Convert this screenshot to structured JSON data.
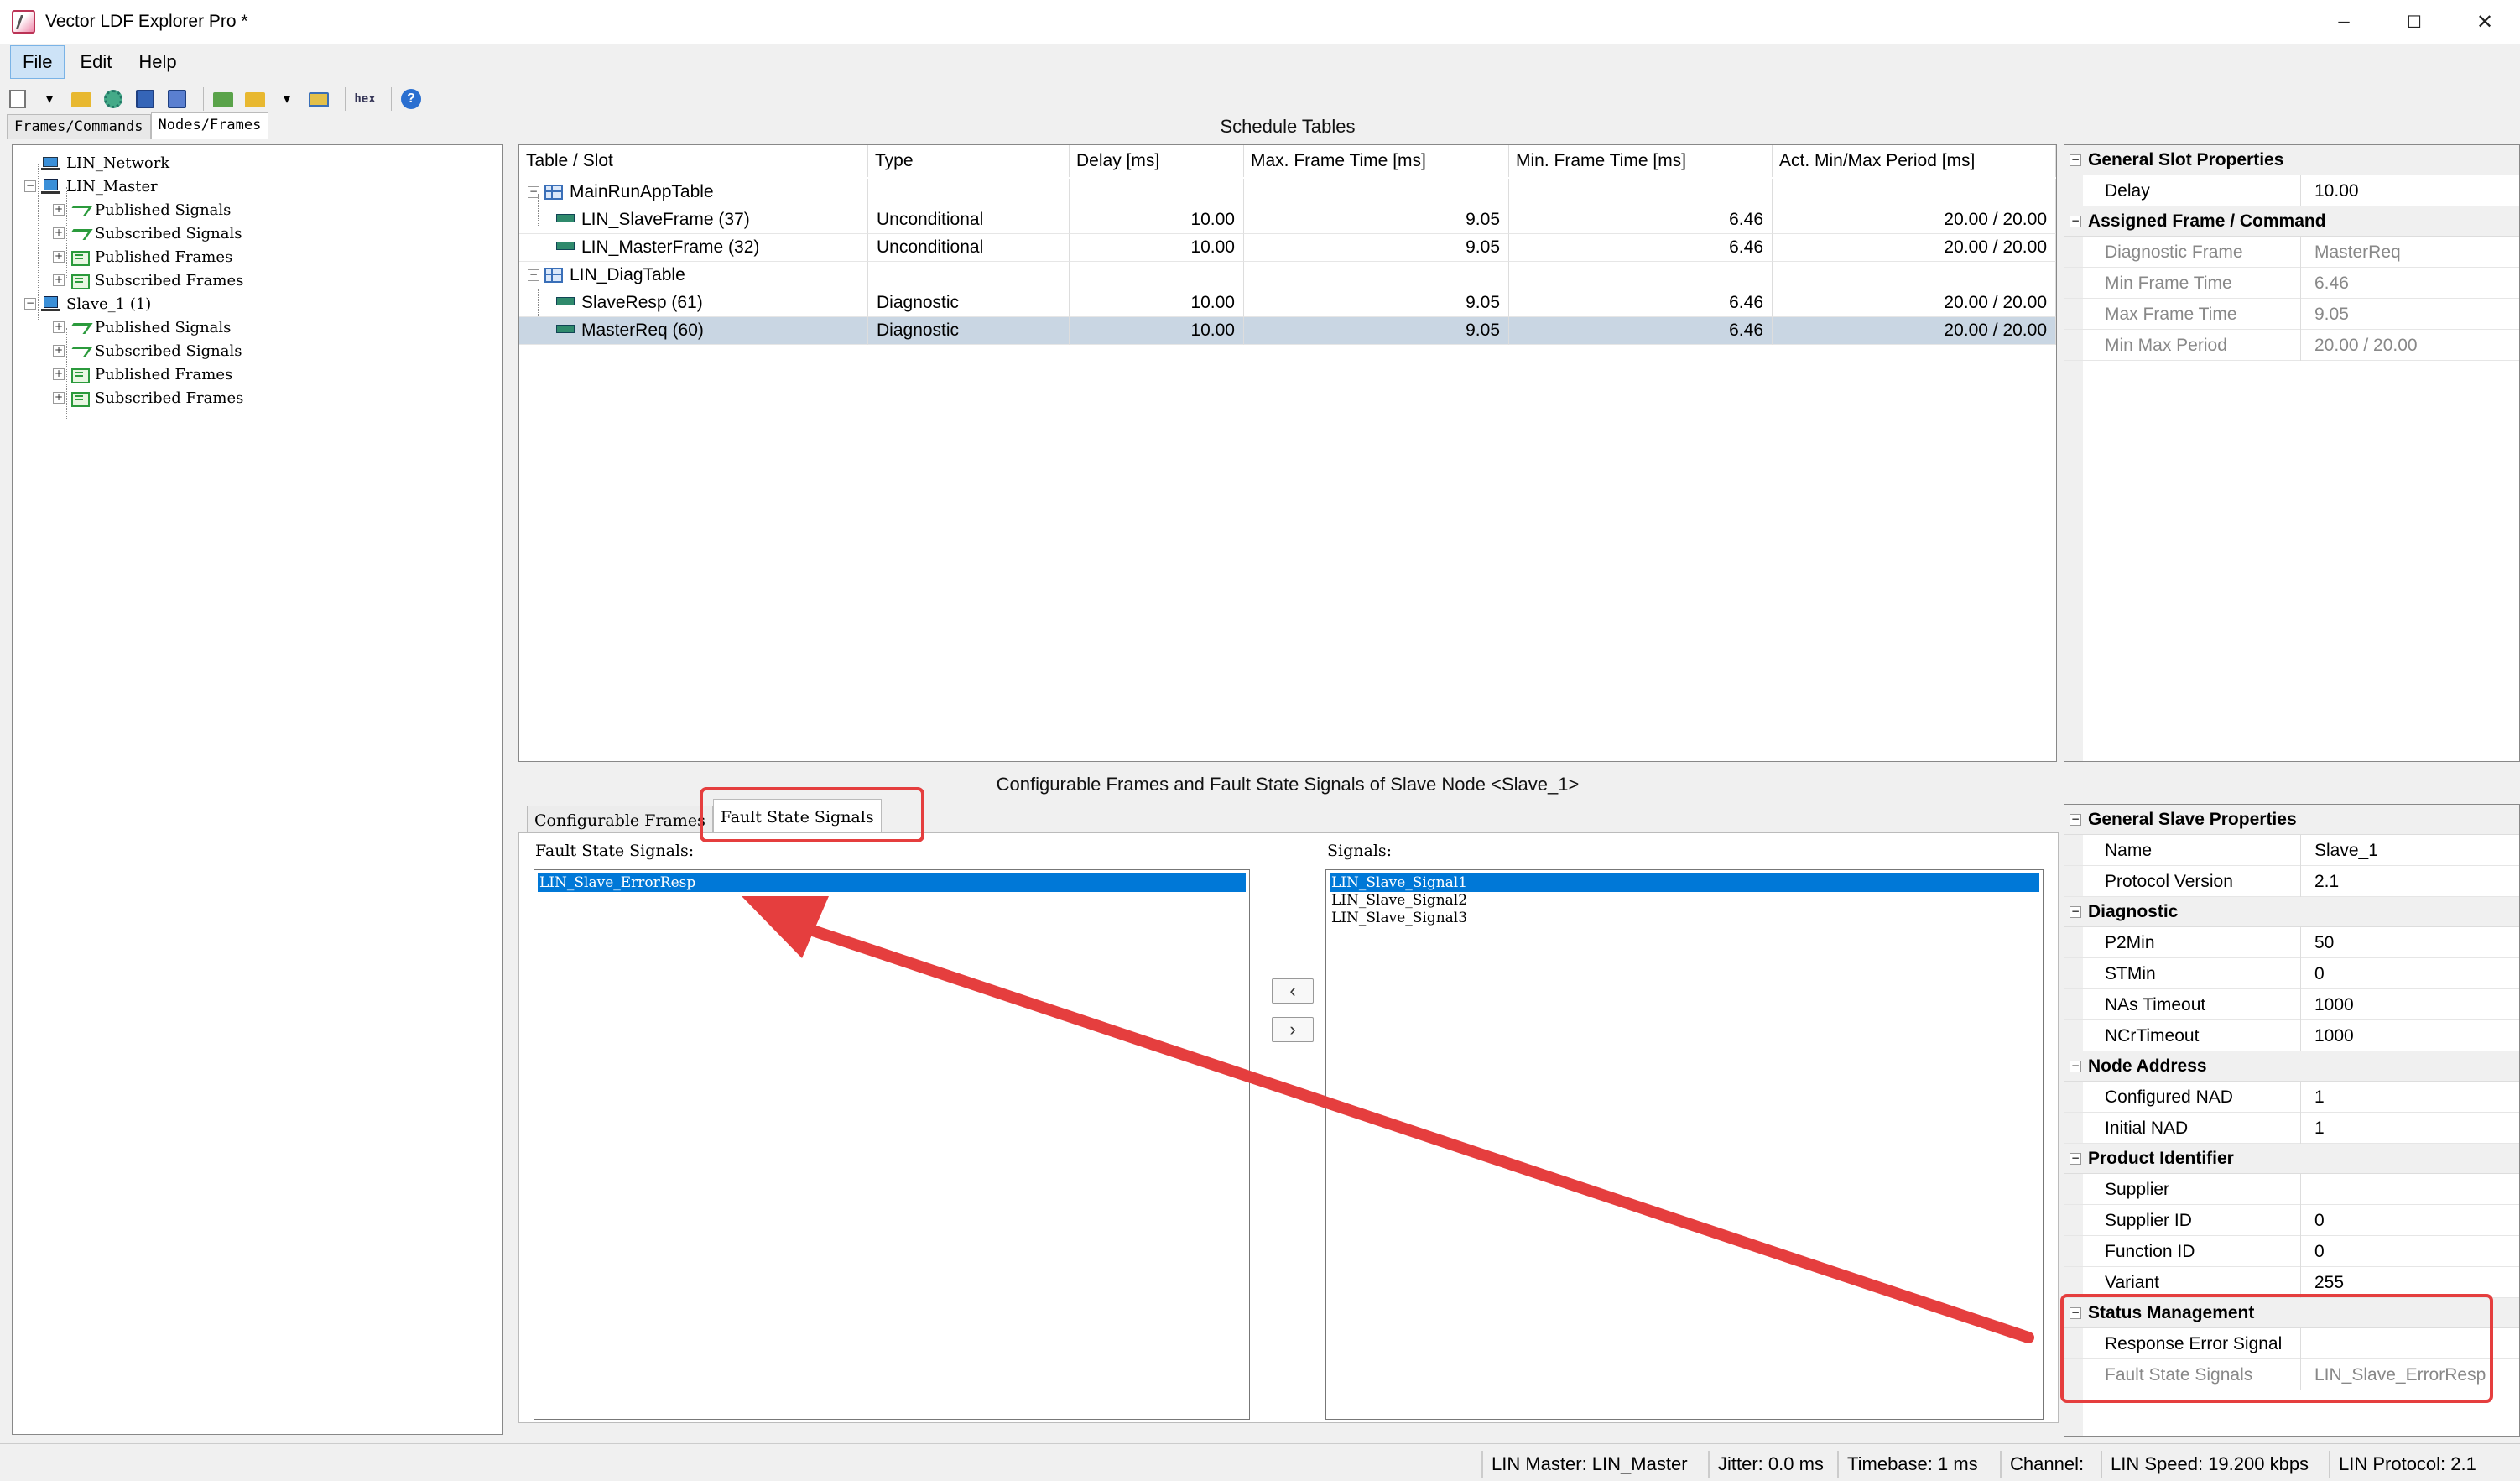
{
  "window": {
    "title": "Vector LDF Explorer Pro *",
    "minimize": "–",
    "maximize": "☐",
    "close": "✕"
  },
  "menu": [
    "File",
    "Edit",
    "Help"
  ],
  "toolbar": {
    "hex_label": "hex"
  },
  "left_tabs": [
    "Frames/Commands",
    "Nodes/Frames"
  ],
  "tree": [
    {
      "label": "LIN_Network",
      "icon": "network-icon",
      "level": 0
    },
    {
      "label": "LIN_Master",
      "icon": "node-icon",
      "level": 0,
      "expander": "−"
    },
    {
      "label": "Published Signals",
      "icon": "signal-icon",
      "level": 1,
      "expander": "+"
    },
    {
      "label": "Subscribed Signals",
      "icon": "signal-icon",
      "level": 1,
      "expander": "+"
    },
    {
      "label": "Published Frames",
      "icon": "frame-icon",
      "level": 1,
      "expander": "+"
    },
    {
      "label": "Subscribed Frames",
      "icon": "frame-icon",
      "level": 1,
      "expander": "+"
    },
    {
      "label": "Slave_1 (1)",
      "icon": "node-icon",
      "level": 0,
      "expander": "−"
    },
    {
      "label": "Published Signals",
      "icon": "signal-icon",
      "level": 1,
      "expander": "+"
    },
    {
      "label": "Subscribed Signals",
      "icon": "signal-icon",
      "level": 1,
      "expander": "+"
    },
    {
      "label": "Published Frames",
      "icon": "frame-icon",
      "level": 1,
      "expander": "+"
    },
    {
      "label": "Subscribed Frames",
      "icon": "frame-icon",
      "level": 1,
      "expander": "+"
    }
  ],
  "schedule": {
    "title": "Schedule Tables",
    "columns": [
      "Table / Slot",
      "Type",
      "Delay [ms]",
      "Max. Frame Time [ms]",
      "Min. Frame Time [ms]",
      "Act. Min/Max Period [ms]"
    ],
    "rows": [
      {
        "name": "MainRunAppTable",
        "kind": "table",
        "expander": "−",
        "cells": [
          "",
          "",
          "",
          "",
          ""
        ]
      },
      {
        "name": "LIN_SlaveFrame (37)",
        "kind": "slot",
        "cells": [
          "Unconditional",
          "10.00",
          "9.05",
          "6.46",
          "20.00 / 20.00"
        ]
      },
      {
        "name": "LIN_MasterFrame (32)",
        "kind": "slot",
        "cells": [
          "Unconditional",
          "10.00",
          "9.05",
          "6.46",
          "20.00 / 20.00"
        ]
      },
      {
        "name": "LIN_DiagTable",
        "kind": "table",
        "expander": "−",
        "cells": [
          "",
          "",
          "",
          "",
          ""
        ]
      },
      {
        "name": "SlaveResp (61)",
        "kind": "slot",
        "cells": [
          "Diagnostic",
          "10.00",
          "9.05",
          "6.46",
          "20.00 / 20.00"
        ]
      },
      {
        "name": "MasterReq (60)",
        "kind": "slot",
        "selected": true,
        "cells": [
          "Diagnostic",
          "10.00",
          "9.05",
          "6.46",
          "20.00 / 20.00"
        ]
      }
    ]
  },
  "slot_props": {
    "categories": [
      {
        "name": "General Slot Properties",
        "items": [
          {
            "k": "Delay",
            "v": "10.00",
            "ro": false
          }
        ]
      },
      {
        "name": "Assigned Frame / Command",
        "items": [
          {
            "k": "Diagnostic Frame",
            "v": "MasterReq",
            "ro": true
          },
          {
            "k": "Min Frame Time",
            "v": "6.46",
            "ro": true
          },
          {
            "k": "Max Frame Time",
            "v": "9.05",
            "ro": true
          },
          {
            "k": "Min Max Period",
            "v": "20.00 / 20.00",
            "ro": true
          }
        ]
      }
    ]
  },
  "bottom": {
    "title": "Configurable Frames and Fault State Signals of Slave Node <Slave_1>",
    "tabs": [
      "Configurable Frames",
      "Fault State Signals"
    ],
    "fault_label": "Fault State Signals:",
    "signals_label": "Signals:",
    "fault_signals": [
      "LIN_Slave_ErrorResp"
    ],
    "signals": [
      "LIN_Slave_Signal1",
      "LIN_Slave_Signal2",
      "LIN_Slave_Signal3"
    ],
    "move_left": "‹",
    "move_right": "›"
  },
  "slave_props": {
    "categories": [
      {
        "name": "General Slave Properties",
        "items": [
          {
            "k": "Name",
            "v": "Slave_1",
            "ro": false
          },
          {
            "k": "Protocol Version",
            "v": "2.1",
            "ro": false
          }
        ]
      },
      {
        "name": "Diagnostic",
        "items": [
          {
            "k": "P2Min",
            "v": "50",
            "ro": false
          },
          {
            "k": "STMin",
            "v": "0",
            "ro": false
          },
          {
            "k": "NAs Timeout",
            "v": "1000",
            "ro": false
          },
          {
            "k": "NCrTimeout",
            "v": "1000",
            "ro": false
          }
        ]
      },
      {
        "name": "Node Address",
        "items": [
          {
            "k": "Configured NAD",
            "v": "1",
            "ro": false
          },
          {
            "k": "Initial NAD",
            "v": "1",
            "ro": false
          }
        ]
      },
      {
        "name": "Product Identifier",
        "items": [
          {
            "k": "Supplier",
            "v": "",
            "ro": false
          },
          {
            "k": "Supplier ID",
            "v": "0",
            "ro": false
          },
          {
            "k": "Function ID",
            "v": "0",
            "ro": false
          },
          {
            "k": "Variant",
            "v": "255",
            "ro": false
          }
        ]
      },
      {
        "name": "Status Management",
        "items": [
          {
            "k": "Response Error Signal",
            "v": "",
            "ro": false
          },
          {
            "k": "Fault State Signals",
            "v": "LIN_Slave_ErrorResp",
            "ro": true
          }
        ]
      }
    ]
  },
  "status": [
    "LIN Master: LIN_Master",
    "Jitter: 0.0 ms",
    "Timebase: 1 ms",
    "Channel:",
    "LIN Speed: 19.200 kbps",
    "LIN Protocol: 2.1"
  ],
  "annotation_color": "#e53e3e"
}
